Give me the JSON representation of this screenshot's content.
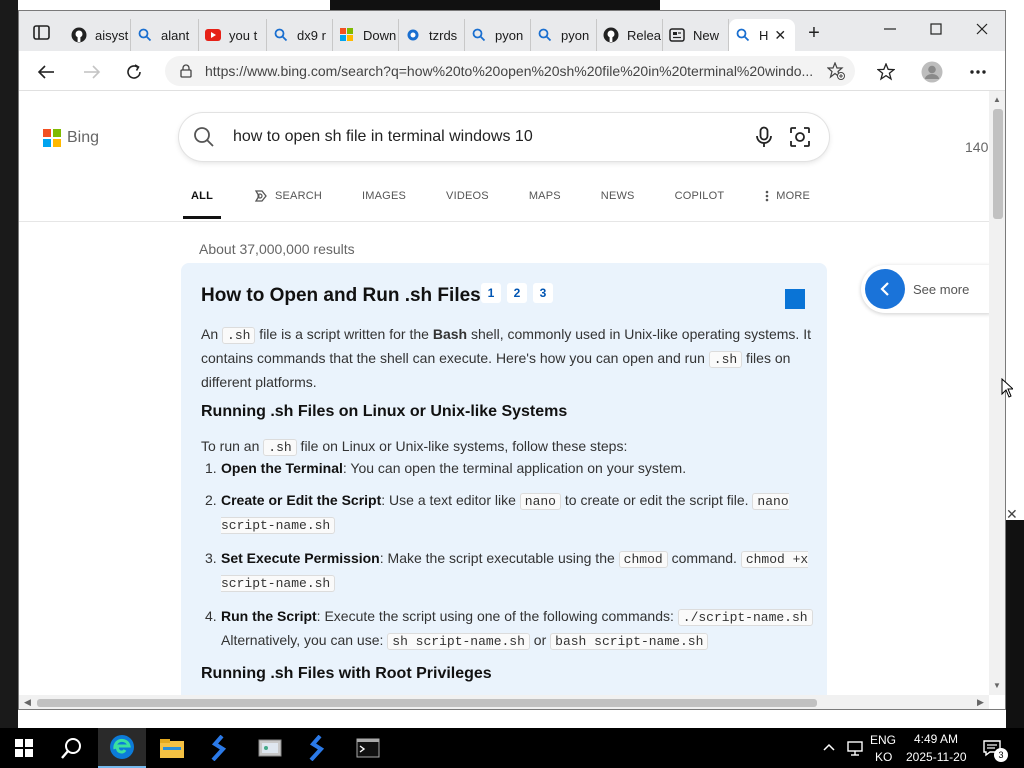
{
  "browser": {
    "tabs": [
      {
        "icon": "github-icon",
        "label": "aisyst"
      },
      {
        "icon": "bing-search-icon",
        "label": "alant"
      },
      {
        "icon": "youtube-icon",
        "label": "you t"
      },
      {
        "icon": "bing-search-icon",
        "label": "dx9 r"
      },
      {
        "icon": "microsoft-icon",
        "label": "Down"
      },
      {
        "icon": "cloud-icon",
        "label": "tzrds"
      },
      {
        "icon": "bing-search-icon",
        "label": "pyon"
      },
      {
        "icon": "bing-search-icon",
        "label": "pyon"
      },
      {
        "icon": "github-icon",
        "label": "Relea"
      },
      {
        "icon": "newtab-page-icon",
        "label": "New"
      },
      {
        "icon": "bing-search-icon",
        "label": "H",
        "active": true
      }
    ],
    "url": "https://www.bing.com/search?q=how%20to%20open%20sh%20file%20in%20terminal%20windo..."
  },
  "bing": {
    "logo_text": "Bing",
    "query": "how to open sh file in terminal windows 10",
    "reward_count": "140",
    "scopes": [
      "ALL",
      "SEARCH",
      "IMAGES",
      "VIDEOS",
      "MAPS",
      "NEWS",
      "COPILOT",
      "MORE"
    ],
    "results_count": "About 37,000,000 results",
    "see_more": "See more"
  },
  "answer": {
    "title": "How to Open and Run .sh Files",
    "refs": [
      "1",
      "2",
      "3"
    ],
    "intro": {
      "t1": "An ",
      "c1": ".sh",
      "t2": " file is a script written for the ",
      "b1": "Bash",
      "t3": " shell, commonly used in Unix-like operating systems. It contains commands that the shell can execute. Here's how you can open and run ",
      "c2": ".sh",
      "t4": " files on different platforms."
    },
    "section1": "Running .sh Files on Linux or Unix-like Systems",
    "to_run": {
      "t1": "To run an ",
      "c1": ".sh",
      "t2": " file on Linux or Unix-like systems, follow these steps:"
    },
    "steps": [
      {
        "num": "1.",
        "bold": "Open the Terminal",
        "text": ": You can open the terminal application on your system."
      },
      {
        "num": "2.",
        "bold": "Create or Edit the Script",
        "text": ": Use a text editor like ",
        "code1": "nano",
        "text2": " to create or edit the script file. ",
        "code2": "nano script-name.sh"
      },
      {
        "num": "3.",
        "bold": "Set Execute Permission",
        "text": ": Make the script executable using the ",
        "code1": "chmod",
        "text2": " command. ",
        "code2": "chmod +x script-name.sh"
      },
      {
        "num": "4.",
        "bold": "Run the Script",
        "text": ": Execute the script using one of the following commands: ",
        "code1": "./script-name.sh",
        "text2": " Alternatively, you can use: ",
        "code2": "sh script-name.sh",
        "text3": " or ",
        "code3": "bash script-name.sh"
      }
    ],
    "section2": "Running .sh Files with Root Privileges"
  },
  "taskbar": {
    "apps": [
      "start-icon",
      "search-icon",
      "edge-icon",
      "file-explorer-icon",
      "blue-app-icon",
      "control-panel-icon",
      "blue-app-icon",
      "terminal-icon"
    ],
    "lang_top": "ENG",
    "lang_bottom": "KO",
    "time": "4:49 AM",
    "date": "2025-11-20",
    "notifications": "3"
  },
  "colors": {
    "accent": "#0a74d6",
    "card_bg": "#eaf3fc",
    "ms_red": "#f25022",
    "ms_green": "#7fba00",
    "ms_blue": "#00a4ef",
    "ms_yellow": "#ffb900"
  }
}
